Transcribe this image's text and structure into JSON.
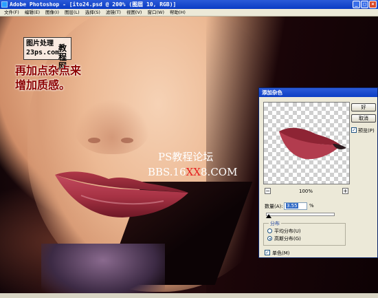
{
  "window": {
    "title": "Adobe Photoshop - [ito24.psd @ 200% (图层 10, RGB)]",
    "controls": [
      "_",
      "□",
      "×"
    ]
  },
  "menu": [
    "文件(F)",
    "编辑(E)",
    "图像(I)",
    "图层(L)",
    "选择(S)",
    "滤镜(T)",
    "视图(V)",
    "窗口(W)",
    "帮助(H)"
  ],
  "watermark_logo": {
    "line1": "图片处理",
    "line2": "23ps.com",
    "line3": "教程网"
  },
  "annotation": [
    "再加点杂点来",
    "增加质感。"
  ],
  "watermark": {
    "line1": "PS教程论坛",
    "line2_prefix": "BBS.16",
    "line2_highlight": "XX",
    "line2_suffix": "8.COM"
  },
  "dialog": {
    "title": "添加杂色",
    "ok_label": "好",
    "cancel_label": "取消",
    "preview_label": "预览(P)",
    "preview_checked": true,
    "zoom_minus": "−",
    "zoom_plus": "+",
    "zoom_value": "100%",
    "amount_label": "数量(A):",
    "amount_value": "3.55",
    "amount_unit": "%",
    "amount_slider_fraction": 0.035,
    "distribution_label": "分布",
    "uniform_label": "平均分布(U)",
    "gaussian_label": "高斯分布(G)",
    "selected_distribution": "gaussian",
    "monochrome_label": "单色(M)",
    "monochrome_checked": true
  },
  "colors": {
    "annotation": "#8b0000",
    "watermark_highlight": "#e62020",
    "titlebar": "#0a3bc4"
  }
}
